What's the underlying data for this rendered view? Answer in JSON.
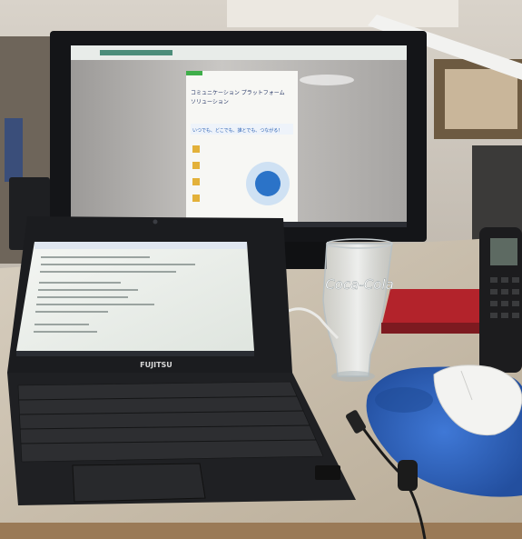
{
  "photo": {
    "monitor": {
      "brochure_heading": "コミュニケーション プラットフォーム",
      "brochure_heading_2": "ソリューション",
      "brochure_tagline": "いつでも、どこでも、誰とでも、つながる！"
    },
    "laptop": {
      "brand": "FUJITSU"
    },
    "glass": {
      "logo": "Coca-Cola"
    },
    "colors": {
      "wall": "#cdc6bb",
      "desk": "#c7bca9",
      "mousepad": "#2f66c6",
      "laptop_body": "#1b1c1f",
      "monitor_bezel": "#141518",
      "red_tray": "#b3232b",
      "mouse": "#f3f3f1"
    }
  }
}
